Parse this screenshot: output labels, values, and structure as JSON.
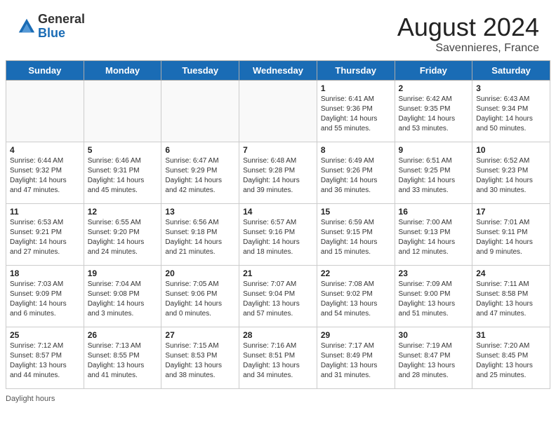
{
  "header": {
    "logo_general": "General",
    "logo_blue": "Blue",
    "title": "August 2024",
    "subtitle": "Savennieres, France"
  },
  "days_of_week": [
    "Sunday",
    "Monday",
    "Tuesday",
    "Wednesday",
    "Thursday",
    "Friday",
    "Saturday"
  ],
  "weeks": [
    [
      {
        "num": "",
        "detail": ""
      },
      {
        "num": "",
        "detail": ""
      },
      {
        "num": "",
        "detail": ""
      },
      {
        "num": "",
        "detail": ""
      },
      {
        "num": "1",
        "detail": "Sunrise: 6:41 AM\nSunset: 9:36 PM\nDaylight: 14 hours\nand 55 minutes."
      },
      {
        "num": "2",
        "detail": "Sunrise: 6:42 AM\nSunset: 9:35 PM\nDaylight: 14 hours\nand 53 minutes."
      },
      {
        "num": "3",
        "detail": "Sunrise: 6:43 AM\nSunset: 9:34 PM\nDaylight: 14 hours\nand 50 minutes."
      }
    ],
    [
      {
        "num": "4",
        "detail": "Sunrise: 6:44 AM\nSunset: 9:32 PM\nDaylight: 14 hours\nand 47 minutes."
      },
      {
        "num": "5",
        "detail": "Sunrise: 6:46 AM\nSunset: 9:31 PM\nDaylight: 14 hours\nand 45 minutes."
      },
      {
        "num": "6",
        "detail": "Sunrise: 6:47 AM\nSunset: 9:29 PM\nDaylight: 14 hours\nand 42 minutes."
      },
      {
        "num": "7",
        "detail": "Sunrise: 6:48 AM\nSunset: 9:28 PM\nDaylight: 14 hours\nand 39 minutes."
      },
      {
        "num": "8",
        "detail": "Sunrise: 6:49 AM\nSunset: 9:26 PM\nDaylight: 14 hours\nand 36 minutes."
      },
      {
        "num": "9",
        "detail": "Sunrise: 6:51 AM\nSunset: 9:25 PM\nDaylight: 14 hours\nand 33 minutes."
      },
      {
        "num": "10",
        "detail": "Sunrise: 6:52 AM\nSunset: 9:23 PM\nDaylight: 14 hours\nand 30 minutes."
      }
    ],
    [
      {
        "num": "11",
        "detail": "Sunrise: 6:53 AM\nSunset: 9:21 PM\nDaylight: 14 hours\nand 27 minutes."
      },
      {
        "num": "12",
        "detail": "Sunrise: 6:55 AM\nSunset: 9:20 PM\nDaylight: 14 hours\nand 24 minutes."
      },
      {
        "num": "13",
        "detail": "Sunrise: 6:56 AM\nSunset: 9:18 PM\nDaylight: 14 hours\nand 21 minutes."
      },
      {
        "num": "14",
        "detail": "Sunrise: 6:57 AM\nSunset: 9:16 PM\nDaylight: 14 hours\nand 18 minutes."
      },
      {
        "num": "15",
        "detail": "Sunrise: 6:59 AM\nSunset: 9:15 PM\nDaylight: 14 hours\nand 15 minutes."
      },
      {
        "num": "16",
        "detail": "Sunrise: 7:00 AM\nSunset: 9:13 PM\nDaylight: 14 hours\nand 12 minutes."
      },
      {
        "num": "17",
        "detail": "Sunrise: 7:01 AM\nSunset: 9:11 PM\nDaylight: 14 hours\nand 9 minutes."
      }
    ],
    [
      {
        "num": "18",
        "detail": "Sunrise: 7:03 AM\nSunset: 9:09 PM\nDaylight: 14 hours\nand 6 minutes."
      },
      {
        "num": "19",
        "detail": "Sunrise: 7:04 AM\nSunset: 9:08 PM\nDaylight: 14 hours\nand 3 minutes."
      },
      {
        "num": "20",
        "detail": "Sunrise: 7:05 AM\nSunset: 9:06 PM\nDaylight: 14 hours\nand 0 minutes."
      },
      {
        "num": "21",
        "detail": "Sunrise: 7:07 AM\nSunset: 9:04 PM\nDaylight: 13 hours\nand 57 minutes."
      },
      {
        "num": "22",
        "detail": "Sunrise: 7:08 AM\nSunset: 9:02 PM\nDaylight: 13 hours\nand 54 minutes."
      },
      {
        "num": "23",
        "detail": "Sunrise: 7:09 AM\nSunset: 9:00 PM\nDaylight: 13 hours\nand 51 minutes."
      },
      {
        "num": "24",
        "detail": "Sunrise: 7:11 AM\nSunset: 8:58 PM\nDaylight: 13 hours\nand 47 minutes."
      }
    ],
    [
      {
        "num": "25",
        "detail": "Sunrise: 7:12 AM\nSunset: 8:57 PM\nDaylight: 13 hours\nand 44 minutes."
      },
      {
        "num": "26",
        "detail": "Sunrise: 7:13 AM\nSunset: 8:55 PM\nDaylight: 13 hours\nand 41 minutes."
      },
      {
        "num": "27",
        "detail": "Sunrise: 7:15 AM\nSunset: 8:53 PM\nDaylight: 13 hours\nand 38 minutes."
      },
      {
        "num": "28",
        "detail": "Sunrise: 7:16 AM\nSunset: 8:51 PM\nDaylight: 13 hours\nand 34 minutes."
      },
      {
        "num": "29",
        "detail": "Sunrise: 7:17 AM\nSunset: 8:49 PM\nDaylight: 13 hours\nand 31 minutes."
      },
      {
        "num": "30",
        "detail": "Sunrise: 7:19 AM\nSunset: 8:47 PM\nDaylight: 13 hours\nand 28 minutes."
      },
      {
        "num": "31",
        "detail": "Sunrise: 7:20 AM\nSunset: 8:45 PM\nDaylight: 13 hours\nand 25 minutes."
      }
    ]
  ],
  "footer": {
    "daylight_label": "Daylight hours"
  }
}
